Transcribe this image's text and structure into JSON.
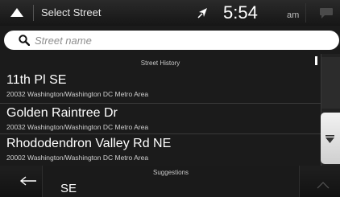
{
  "header": {
    "title": "Select Street",
    "time": "5:54",
    "ampm": "am",
    "icons": [
      "up-arrow-icon",
      "navigation-arrow-icon",
      "message-icon"
    ]
  },
  "search": {
    "placeholder": "Street name",
    "value": ""
  },
  "history": {
    "header": "Street History",
    "items": [
      {
        "title": "11th Pl SE",
        "subtitle": "20032 Washington/Washington DC Metro Area"
      },
      {
        "title": "Golden Raintree Dr",
        "subtitle": "20032 Washington/Washington DC Metro Area"
      },
      {
        "title": "Rhododendron Valley Rd NE",
        "subtitle": "20002 Washington/Washington DC Metro Area"
      }
    ]
  },
  "suggestions": {
    "header": "Suggestions",
    "items": [
      {
        "title": "SE"
      }
    ]
  },
  "colors": {
    "background": "#1b1b1b",
    "text": "#ffffff",
    "muted_text": "#c8c8c8",
    "search_bg": "#ffffff",
    "scroll_button": "#e6e6e6"
  }
}
